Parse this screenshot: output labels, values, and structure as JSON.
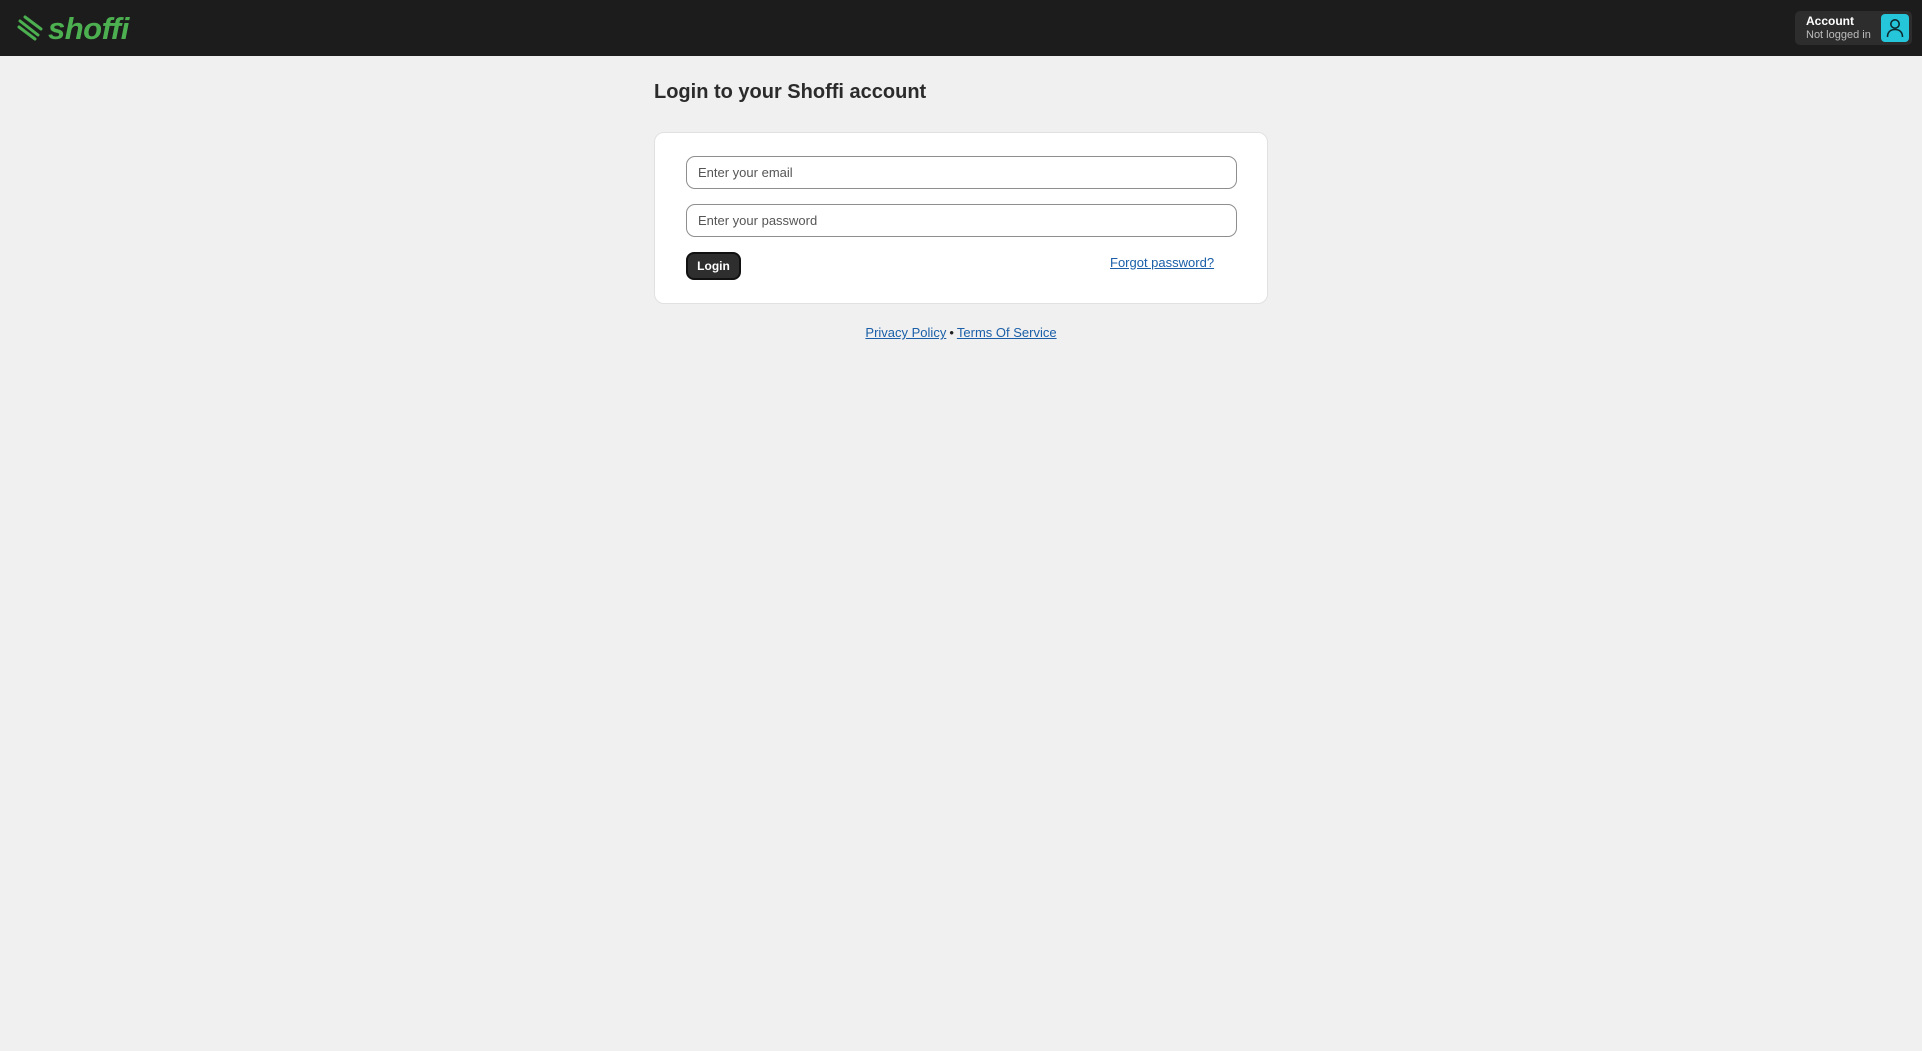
{
  "header": {
    "logo_text": "shoffi",
    "brand_color": "#4caf50",
    "background_color": "#1c1c1c",
    "account": {
      "title": "Account",
      "status": "Not logged in",
      "avatar_icon": "user-icon",
      "avatar_color": "#26c6da"
    }
  },
  "main": {
    "title": "Login to your Shoffi account",
    "form": {
      "email_placeholder": "Enter your email",
      "email_value": "",
      "password_placeholder": "Enter your password",
      "password_value": "",
      "login_label": "Login",
      "forgot_label": "Forgot password?"
    }
  },
  "footer": {
    "privacy_label": "Privacy Policy",
    "separator": "•",
    "terms_label": "Terms Of Service",
    "link_color": "#1a5fa8"
  }
}
